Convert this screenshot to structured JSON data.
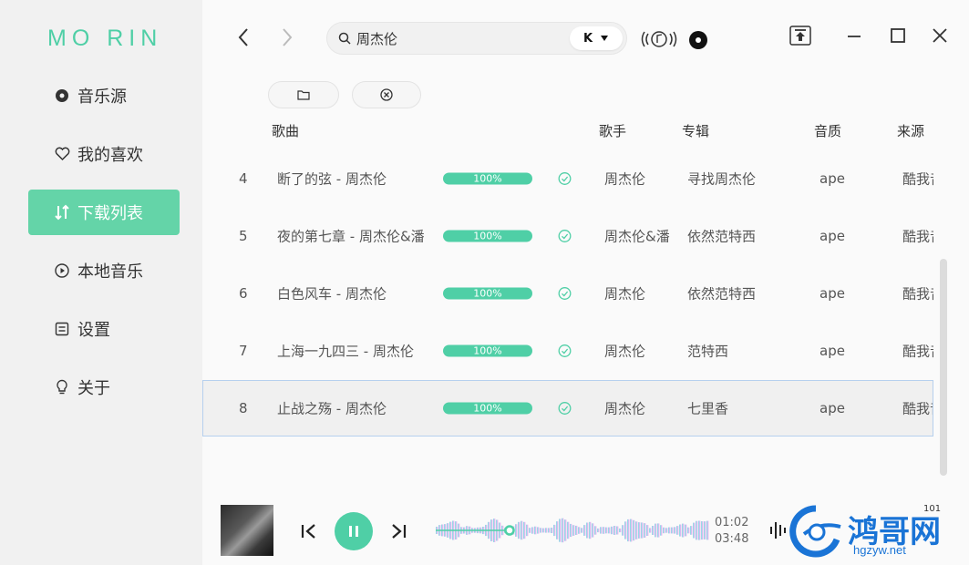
{
  "app": {
    "logo": "MO RIN",
    "accent": "#4fcfa6"
  },
  "sidebar": {
    "items": [
      {
        "label": "音乐源",
        "icon": "disc-icon"
      },
      {
        "label": "我的喜欢",
        "icon": "heart-icon"
      },
      {
        "label": "下载列表",
        "icon": "sort-arrows-icon",
        "active": true
      },
      {
        "label": "本地音乐",
        "icon": "play-circle-icon"
      },
      {
        "label": "设置",
        "icon": "settings-icon"
      },
      {
        "label": "关于",
        "icon": "lightbulb-icon"
      }
    ]
  },
  "search": {
    "value": "周杰伦",
    "source": "K"
  },
  "table": {
    "headers": {
      "song": "歌曲",
      "artist": "歌手",
      "album": "专辑",
      "quality": "音质",
      "source": "来源"
    },
    "rows": [
      {
        "num": "4",
        "title": "断了的弦 - 周杰伦",
        "progress": "100%",
        "artist": "周杰伦",
        "album": "寻找周杰伦",
        "quality": "ape",
        "source": "酷我音乐"
      },
      {
        "num": "5",
        "title": "夜的第七章 - 周杰伦&潘",
        "progress": "100%",
        "artist": "周杰伦&潘",
        "album": "依然范特西",
        "quality": "ape",
        "source": "酷我音乐"
      },
      {
        "num": "6",
        "title": "白色风车 - 周杰伦",
        "progress": "100%",
        "artist": "周杰伦",
        "album": "依然范特西",
        "quality": "ape",
        "source": "酷我音乐"
      },
      {
        "num": "7",
        "title": "上海一九四三 - 周杰伦",
        "progress": "100%",
        "artist": "周杰伦",
        "album": "范特西",
        "quality": "ape",
        "source": "酷我音乐"
      },
      {
        "num": "8",
        "title": "止战之殇 - 周杰伦",
        "progress": "100%",
        "artist": "周杰伦",
        "album": "七里香",
        "quality": "ape",
        "source": "酷我音乐"
      }
    ]
  },
  "player": {
    "current_time": "01:02",
    "total_time": "03:48",
    "progress_fraction": 0.27,
    "volume": "101"
  },
  "watermark": {
    "text": "鸿哥网",
    "url": "hgzyw.net"
  }
}
